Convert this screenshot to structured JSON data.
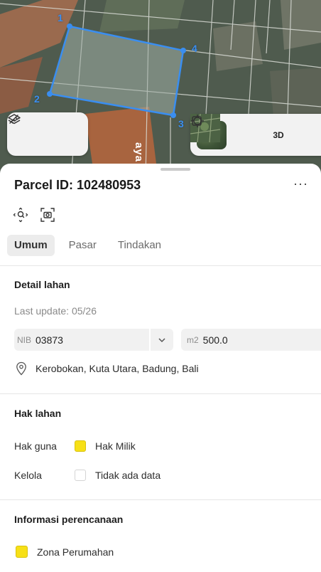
{
  "map": {
    "vertex_labels": [
      "1",
      "2",
      "3",
      "4"
    ],
    "street_label": "aya",
    "tools_left": [
      "layers-icon",
      "measure-icon"
    ],
    "tools_right": [
      "basemap-thumbnail",
      "locate-icon",
      "3d-toggle",
      "more-map-icon"
    ],
    "three_d_label": "3D",
    "parcel_color": "#3a8ef0"
  },
  "sheet": {
    "title": "Parcel ID: 102480953",
    "more_label": "···",
    "action_icons": [
      "zoom-to-parcel-icon",
      "screenshot-icon"
    ],
    "tabs": [
      {
        "label": "Umum",
        "active": true
      },
      {
        "label": "Pasar",
        "active": false
      },
      {
        "label": "Tindakan",
        "active": false
      }
    ],
    "detail": {
      "title": "Detail lahan",
      "last_update": "Last update: 05/26",
      "nib_prefix": "NIB",
      "nib_value": "03873",
      "area_prefix": "m2",
      "area_value": "500.0",
      "location": "Kerobokan, Kuta Utara, Badung, Bali"
    },
    "rights": {
      "title": "Hak lahan",
      "rows": [
        {
          "label": "Hak guna",
          "value": "Hak Milik",
          "color": "#f7e017"
        },
        {
          "label": "Kelola",
          "value": "Tidak ada data",
          "color": "#ffffff"
        }
      ]
    },
    "planning": {
      "title": "Informasi perencanaan",
      "zone": "Zona Perumahan",
      "zone_color": "#f7e017"
    }
  }
}
